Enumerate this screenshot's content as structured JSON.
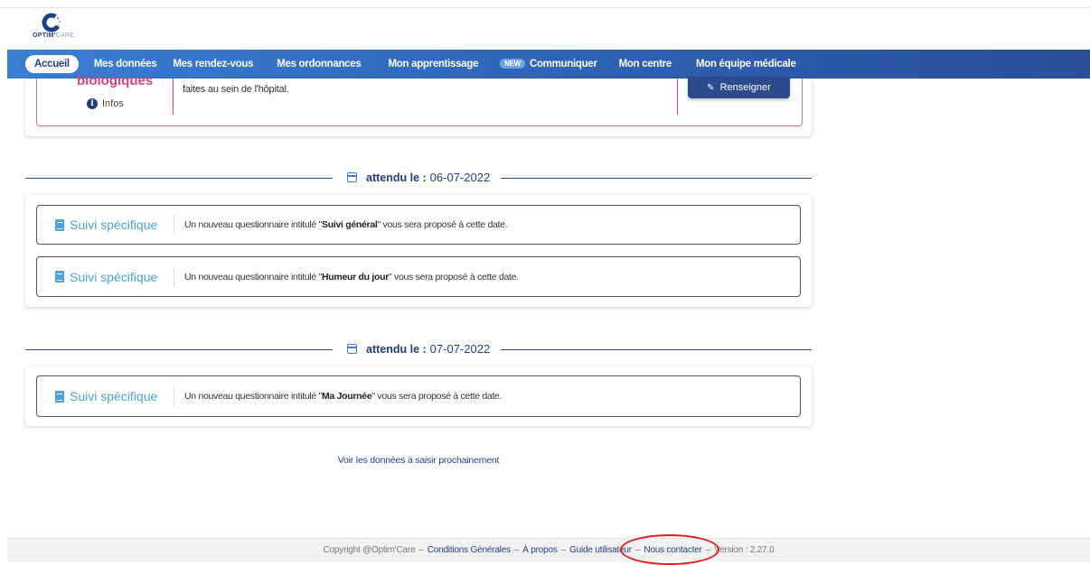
{
  "logo": {
    "brand": "OPTIM",
    "brand_suffix": "CARE"
  },
  "nav": {
    "items": [
      {
        "label": "Accueil",
        "active": true
      },
      {
        "label": "Mes données"
      },
      {
        "label": "Mes rendez-vous"
      },
      {
        "label": "Mes ordonnances"
      },
      {
        "label": "Mon apprentissage"
      },
      {
        "label": "Communiquer",
        "badge": "NEW"
      },
      {
        "label": "Mon centre"
      },
      {
        "label": "Mon équipe médicale"
      }
    ]
  },
  "top_card": {
    "title": "biologiques",
    "infos": "Infos",
    "text": "faites au sein de l'hôpital.",
    "button": "Renseigner"
  },
  "groups": [
    {
      "label": "attendu le :",
      "date": "06-07-2022",
      "rows": [
        {
          "type": "Suivi spécifique",
          "prefix": "Un nouveau questionnaire intitulé \"",
          "name": "Suivi général",
          "suffix": "\" vous sera proposé à cette date."
        },
        {
          "type": "Suivi spécifique",
          "prefix": "Un nouveau questionnaire intitulé \"",
          "name": "Humeur du jour",
          "suffix": "\" vous sera proposé à cette date."
        }
      ]
    },
    {
      "label": "attendu le :",
      "date": "07-07-2022",
      "rows": [
        {
          "type": "Suivi spécifique",
          "prefix": "Un nouveau questionnaire intitulé \"",
          "name": "Ma Journée",
          "suffix": "\" vous sera proposé à cette date."
        }
      ]
    }
  ],
  "voir_link": "Voir les données à saisir prochainement",
  "footer": {
    "copyright": "Copyright @Optim'Care",
    "links": [
      "Conditions Générales",
      "À propos",
      "Guide utilisateur",
      "Nous contacter"
    ],
    "version": "Version : 2.27.0"
  },
  "colors": {
    "nav": "#2d5fb0",
    "accent": "#4aa3df",
    "pink": "#d8436f",
    "highlight": "#e01b1b"
  }
}
